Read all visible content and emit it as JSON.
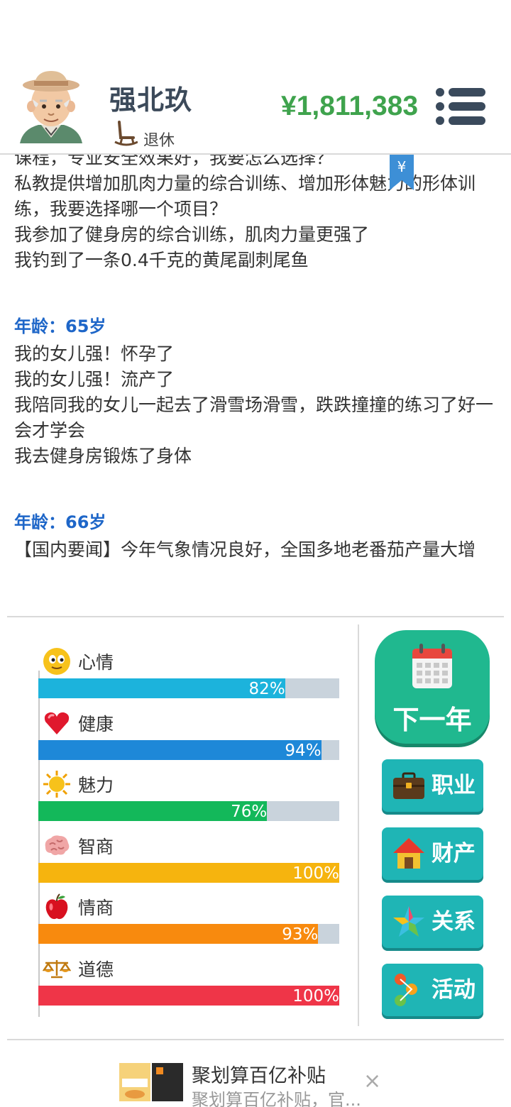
{
  "header": {
    "name": "强北玖",
    "status": "退休",
    "money": "¥1,811,383"
  },
  "log": {
    "cut_line": "课程，专业安全效果好，我要怎么选择？",
    "lines_a": [
      "私教提供增加肌肉力量的综合训练、增加形体魅力的形体训练，我要选择哪一个项目？",
      "我参加了健身房的综合训练，肌肉力量更强了",
      "我钓到了一条0.4千克的黄尾副刺尾鱼"
    ],
    "age_65": "年龄：65岁",
    "lines_65": [
      "我的女儿强！怀孕了",
      "我的女儿强！流产了",
      "我陪同我的女儿一起去了滑雪场滑雪，跌跌撞撞的练习了好一会才学会",
      "我去健身房锻炼了身体"
    ],
    "age_66": "年龄：66岁",
    "lines_66": [
      "【国内要闻】今年气象情况良好，全国多地老番茄产量大增"
    ]
  },
  "stats": [
    {
      "label": "心情",
      "pct_text": "82%",
      "value": 0.82,
      "color": "#1cb3dc",
      "icon": "smiley-icon"
    },
    {
      "label": "健康",
      "pct_text": "94%",
      "value": 0.94,
      "color": "#1e88d8",
      "icon": "heart-icon"
    },
    {
      "label": "魅力",
      "pct_text": "76%",
      "value": 0.76,
      "color": "#13b85a",
      "icon": "sun-icon"
    },
    {
      "label": "智商",
      "pct_text": "100%",
      "value": 1.0,
      "color": "#f6b40e",
      "icon": "brain-icon"
    },
    {
      "label": "情商",
      "pct_text": "93%",
      "value": 0.93,
      "color": "#f88a0e",
      "icon": "apple-icon"
    },
    {
      "label": "道德",
      "pct_text": "100%",
      "value": 1.0,
      "color": "#ef3548",
      "icon": "scales-icon"
    }
  ],
  "buttons": {
    "next_year": "下一年",
    "career": "职业",
    "assets": "财产",
    "relations": "关系",
    "activities": "活动"
  },
  "ad": {
    "title": "聚划算百亿补贴",
    "subtitle": "聚划算百亿补贴，官...",
    "close": "×"
  },
  "colors": {
    "money": "#3fa34d",
    "age_title": "#1e66c8",
    "next_button": "#20b88f",
    "side_button": "#1fb5b5"
  }
}
